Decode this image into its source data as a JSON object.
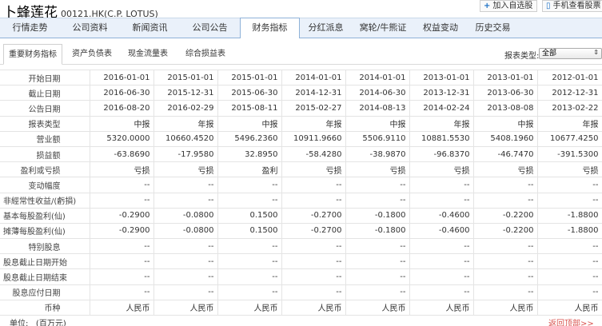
{
  "header": {
    "company_name": "卜蜂莲花",
    "stock_code": "00121.HK(C.P. LOTUS)",
    "add_watchlist_label": "加入自选股",
    "mobile_view_label": "手机查看股票"
  },
  "main_tabs": [
    {
      "label": "行情走势"
    },
    {
      "label": "公司资料"
    },
    {
      "label": "新闻资讯"
    },
    {
      "label": "公司公告"
    },
    {
      "label": "财务指标"
    },
    {
      "label": "分红派息"
    },
    {
      "label": "窝轮/牛熊证"
    },
    {
      "label": "权益变动"
    },
    {
      "label": "历史交易"
    }
  ],
  "sub_tabs": [
    {
      "label": "重要财务指标"
    },
    {
      "label": "资产负债表"
    },
    {
      "label": "现金流量表"
    },
    {
      "label": "综合损益表"
    }
  ],
  "report_type": {
    "label": "报表类型:",
    "selected": "全部"
  },
  "table": {
    "rows": [
      {
        "label": "开始日期",
        "values": [
          "2016-01-01",
          "2015-01-01",
          "2015-01-01",
          "2014-01-01",
          "2014-01-01",
          "2013-01-01",
          "2013-01-01",
          "2012-01-01"
        ]
      },
      {
        "label": "截止日期",
        "values": [
          "2016-06-30",
          "2015-12-31",
          "2015-06-30",
          "2014-12-31",
          "2014-06-30",
          "2013-12-31",
          "2013-06-30",
          "2012-12-31"
        ]
      },
      {
        "label": "公告日期",
        "values": [
          "2016-08-20",
          "2016-02-29",
          "2015-08-11",
          "2015-02-27",
          "2014-08-13",
          "2014-02-24",
          "2013-08-08",
          "2013-02-22"
        ]
      },
      {
        "label": "报表类型",
        "values": [
          "中报",
          "年报",
          "中报",
          "年报",
          "中报",
          "年报",
          "中报",
          "年报"
        ]
      },
      {
        "label": "营业额",
        "values": [
          "5320.0000",
          "10660.4520",
          "5496.2360",
          "10911.9660",
          "5506.9110",
          "10881.5530",
          "5408.1960",
          "10677.4250"
        ]
      },
      {
        "label": "损益额",
        "values": [
          "-63.8690",
          "-17.9580",
          "32.8950",
          "-58.4280",
          "-38.9870",
          "-96.8370",
          "-46.7470",
          "-391.5300"
        ]
      },
      {
        "label": "盈利或亏损",
        "values": [
          "亏损",
          "亏损",
          "盈利",
          "亏损",
          "亏损",
          "亏损",
          "亏损",
          "亏损"
        ]
      },
      {
        "label": "变动幅度",
        "values": [
          "--",
          "--",
          "--",
          "--",
          "--",
          "--",
          "--",
          "--"
        ]
      },
      {
        "label": "非經常性收益/(虧損)",
        "values": [
          "--",
          "--",
          "--",
          "--",
          "--",
          "--",
          "--",
          "--"
        ]
      },
      {
        "label": "基本每股盈利(仙)",
        "values": [
          "-0.2900",
          "-0.0800",
          "0.1500",
          "-0.2700",
          "-0.1800",
          "-0.4600",
          "-0.2200",
          "-1.8800"
        ]
      },
      {
        "label": "摊薄每股盈利(仙)",
        "values": [
          "-0.2900",
          "-0.0800",
          "0.1500",
          "-0.2700",
          "-0.1800",
          "-0.4600",
          "-0.2200",
          "-1.8800"
        ]
      },
      {
        "label": "特别股息",
        "values": [
          "--",
          "--",
          "--",
          "--",
          "--",
          "--",
          "--",
          "--"
        ]
      },
      {
        "label": "股息截止日期开始",
        "values": [
          "--",
          "--",
          "--",
          "--",
          "--",
          "--",
          "--",
          "--"
        ]
      },
      {
        "label": "股息截止日期结束",
        "values": [
          "--",
          "--",
          "--",
          "--",
          "--",
          "--",
          "--",
          "--"
        ]
      },
      {
        "label": "股息应付日期",
        "values": [
          "--",
          "--",
          "--",
          "--",
          "--",
          "--",
          "--",
          "--"
        ]
      },
      {
        "label": "币种",
        "values": [
          "人民币",
          "人民币",
          "人民币",
          "人民币",
          "人民币",
          "人民币",
          "人民币",
          "人民币"
        ]
      }
    ]
  },
  "footer": {
    "unit_label": "单位:",
    "unit_value": "(百万元)",
    "back_to_top": "返回顶部>>"
  }
}
